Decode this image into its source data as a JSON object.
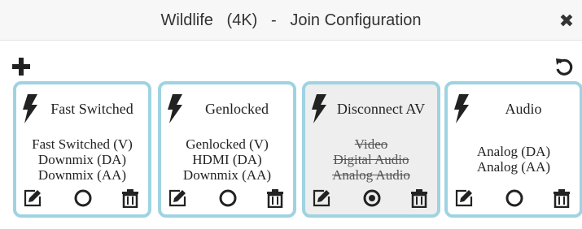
{
  "dialog": {
    "title": "Wildlife   (4K)   -   Join Configuration",
    "close_icon": "close-icon"
  },
  "toolbar": {
    "add_icon": "plus-icon",
    "reset_icon": "refresh-icon"
  },
  "cards": [
    {
      "title": "Fast Switched",
      "lines": [
        "Fast Switched (V)",
        "Downmix (DA)",
        "Downmix (AA)"
      ],
      "selected": false,
      "strikethrough": false
    },
    {
      "title": "Genlocked",
      "lines": [
        "Genlocked (V)",
        "HDMI (DA)",
        "Downmix (AA)"
      ],
      "selected": false,
      "strikethrough": false
    },
    {
      "title": "Disconnect AV",
      "lines": [
        "Video",
        "Digital Audio",
        "Analog Audio"
      ],
      "selected": true,
      "strikethrough": true
    },
    {
      "title": "Audio",
      "lines": [
        "Analog (DA)",
        "Analog (AA)"
      ],
      "selected": false,
      "strikethrough": false
    }
  ],
  "colors": {
    "card_border": "#9fd3e1",
    "active_card_bg": "#eeeeee",
    "titlebar_bg": "#f7f7f7"
  }
}
